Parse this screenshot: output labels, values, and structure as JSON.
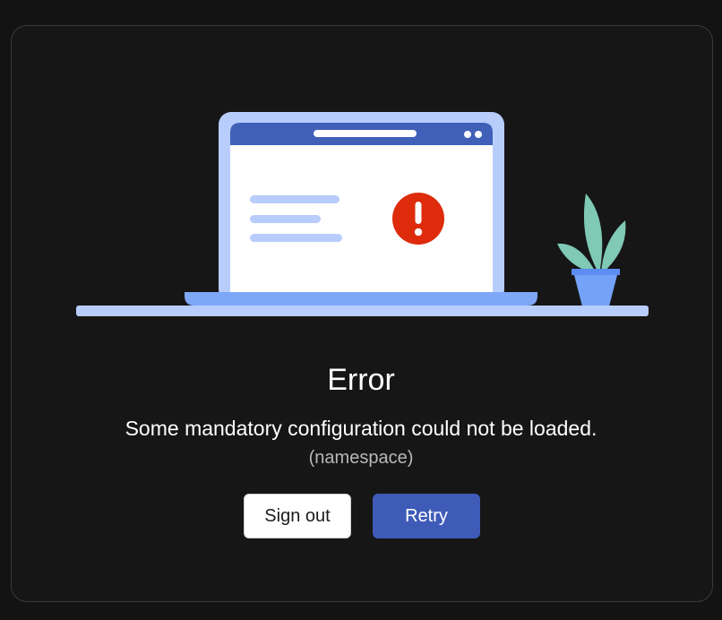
{
  "dialog": {
    "title": "Error",
    "message": "Some mandatory configuration could not be loaded.",
    "detail": "(namespace)"
  },
  "buttons": {
    "sign_out_label": "Sign out",
    "retry_label": "Retry"
  },
  "illustration": {
    "icons": [
      "laptop-icon",
      "error-icon",
      "plant-icon"
    ],
    "colors": {
      "laptop_frame": "#b8cdfc",
      "laptop_titlebar": "#4060b8",
      "laptop_base": "#7ea7f7",
      "error_badge": "#dd2b0c",
      "plant_leaves": "#7fc9b5",
      "plant_pot": "#74a2f8"
    }
  },
  "theme": {
    "background": "#131313",
    "card": "#161616",
    "primary_button": "#3f5bb8"
  }
}
